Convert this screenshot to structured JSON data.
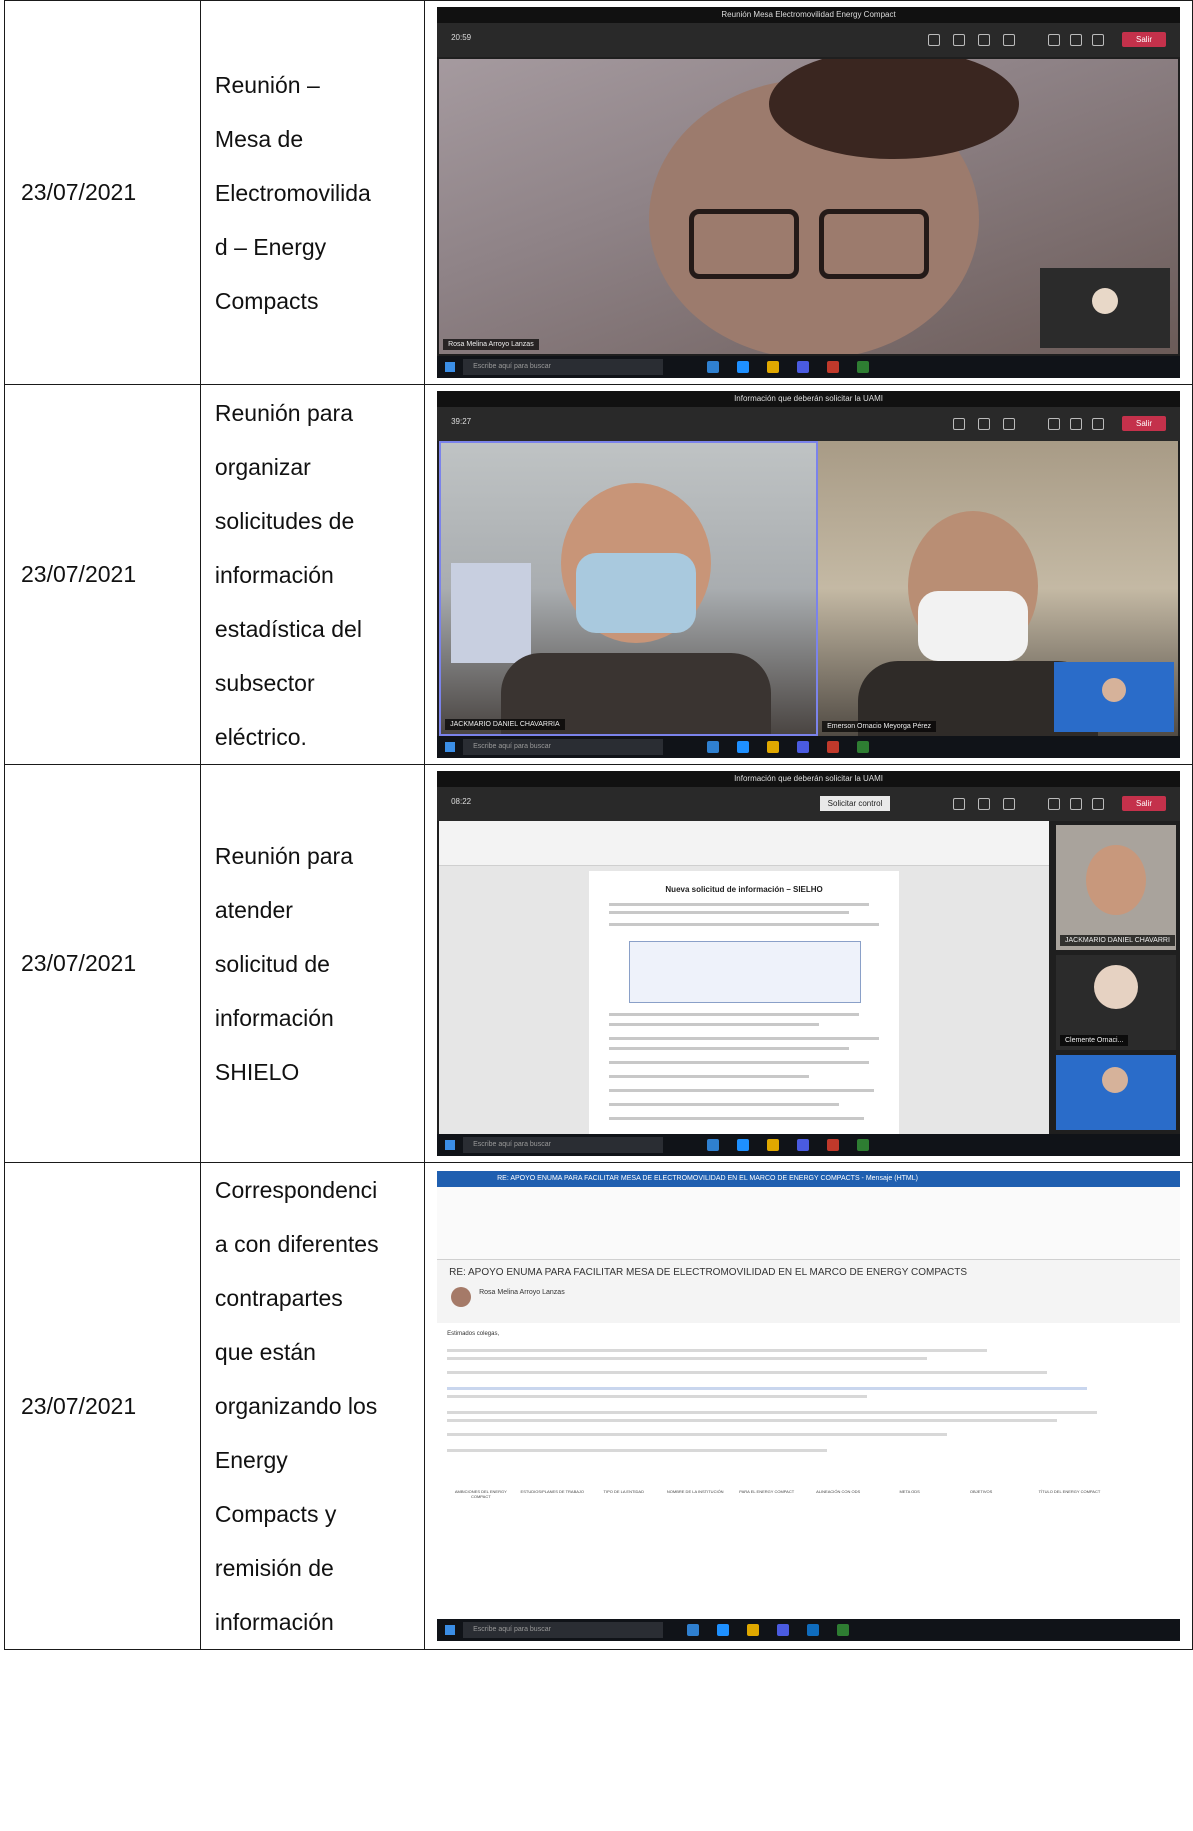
{
  "rows": [
    {
      "date": "23/07/2021",
      "description": "Reunión –\nMesa de\nElectromovilida\nd – Energy\nCompacts",
      "screenshot": {
        "window_title": "Reunión Mesa Electromovilidad Energy Compact",
        "time": "20:59",
        "leave_label": "Salir",
        "participant_name": "Rosa Melina Arroyo Lanzas",
        "search_placeholder": "Escribe aquí para buscar"
      }
    },
    {
      "date": "23/07/2021",
      "description": "Reunión para\norganizar\nsolicitudes de\ninformación\nestadística del\nsubsector\neléctrico.",
      "screenshot": {
        "window_title": "Información que deberán solicitar la UAMI",
        "time": "39:27",
        "leave_label": "Salir",
        "participant_left": "JACKMARIO DANIEL CHAVARRIA",
        "participant_right": "Emerson Ornacio Meyorga Pérez",
        "search_placeholder": "Escribe aquí para buscar"
      }
    },
    {
      "date": "23/07/2021",
      "description": "Reunión para\natender\nsolicitud de\ninformación\nSHIELO",
      "screenshot": {
        "window_title": "Información que deberán solicitar la UAMI",
        "time": "08:22",
        "control_label": "Solicitar control",
        "leave_label": "Salir",
        "doc_heading": "Nueva solicitud de información – SIELHO",
        "participant_1": "JACKMARIO DANIEL CHAVARRI",
        "participant_2": "Clemente Ornaci...",
        "search_placeholder": "Escribe aquí para buscar"
      }
    },
    {
      "date": "23/07/2021",
      "description": "Correspondenci\na con diferentes\ncontrapartes\nque están\norganizando los\nEnergy\nCompacts y\nremisión de\ninformación",
      "screenshot": {
        "window_title": "RE: APOYO ENUMA PARA FACILITAR MESA DE ELECTROMOVILIDAD EN EL MARCO DE ENERGY COMPACTS - Mensaje (HTML)",
        "subject": "RE: APOYO ENUMA PARA FACILITAR MESA DE ELECTROMOVILIDAD EN EL MARCO DE ENERGY COMPACTS",
        "sender": "Rosa Melina Arroyo Lanzas",
        "greeting": "Estimados colegas,",
        "table_headers": [
          "AMBICIONES DEL ENERGY COMPACT",
          "ESTUDIOS/PLANES DE TRABAJO",
          "TIPO DE LA ENTIDAD",
          "NOMBRE DE LA INSTITUCIÓN",
          "PARA EL ENERGY COMPACT",
          "ALINEACIÓN CON ODS",
          "META ODS",
          "OBJETIVOS",
          "TÍTULO DEL ENERGY COMPACT"
        ],
        "search_placeholder": "Escribe aquí para buscar"
      }
    }
  ]
}
